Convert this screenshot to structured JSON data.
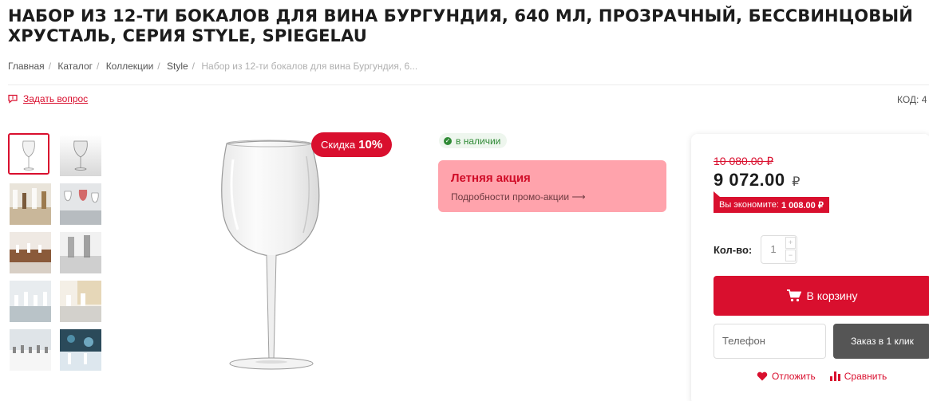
{
  "product": {
    "title": "НАБОР ИЗ 12-ТИ БОКАЛОВ ДЛЯ ВИНА БУРГУНДИЯ, 640 МЛ, ПРОЗРАЧНЫЙ, БЕССВИНЦОВЫЙ ХРУСТАЛЬ, СЕРИЯ STYLE, SPIEGELAU"
  },
  "breadcrumb": [
    {
      "label": "Главная"
    },
    {
      "label": "Каталог"
    },
    {
      "label": "Коллекции"
    },
    {
      "label": "Style"
    },
    {
      "label": "Набор из 12-ти бокалов для вина Бургундия, 6..."
    }
  ],
  "ask_question": {
    "label": "Задать вопрос",
    "icon": "message-icon"
  },
  "code_label": "КОД: 4",
  "gallery": {
    "thumbnails_count": 10,
    "active_index": 0
  },
  "discount_badge": {
    "prefix": "Скидка",
    "value": "10%"
  },
  "availability": {
    "label": "в наличии",
    "color": "#2f8a35"
  },
  "promo": {
    "title": "Летняя акция",
    "link_label": "Подробности промо-акции ⟶"
  },
  "pricing": {
    "old_price": "10 080.00 ₽",
    "price": "9 072.00",
    "currency": "₽",
    "savings_prefix": "Вы экономите:",
    "savings_value": "1 008.00 ₽"
  },
  "quantity": {
    "label": "Кол-во:",
    "value": "1",
    "plus": "+",
    "minus": "−"
  },
  "buttons": {
    "add_to_cart": "В корзину",
    "phone_placeholder": "Телефон",
    "one_click": "Заказ в 1 клик",
    "wishlist": "Отложить",
    "compare": "Сравнить"
  },
  "colors": {
    "accent": "#d90f2e",
    "promo_bg": "#ffa3ac",
    "one_click_bg": "#555555"
  }
}
